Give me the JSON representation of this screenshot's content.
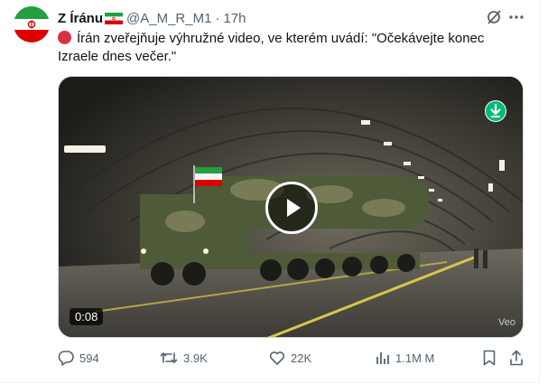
{
  "colors": {
    "text_primary": "#0f1419",
    "text_secondary": "#536471",
    "border": "#cfd9de",
    "download_accent": "#00ba7c",
    "red_dot": "#dd2e44"
  },
  "author": {
    "display_name": "Z Íránu",
    "handle": "@A_M_R_M1",
    "separator": "·",
    "time": "17h"
  },
  "tweet": {
    "text": "Írán zveřejňuje výhružné video, ve kterém uvádí: \"Očekávejte konec Izraele dnes večer.\""
  },
  "media": {
    "duration": "0:08",
    "watermark": "Veo"
  },
  "actions": {
    "replies": "594",
    "reposts": "3.9K",
    "likes": "22K",
    "views": "1.1M M"
  },
  "icons": [
    "iran-flag-avatar",
    "iran-flag-emoji-icon",
    "grok-icon",
    "more-icon",
    "red-circle-icon",
    "play-icon",
    "download-icon",
    "reply-icon",
    "repost-icon",
    "like-icon",
    "views-icon",
    "bookmark-icon",
    "share-icon"
  ]
}
